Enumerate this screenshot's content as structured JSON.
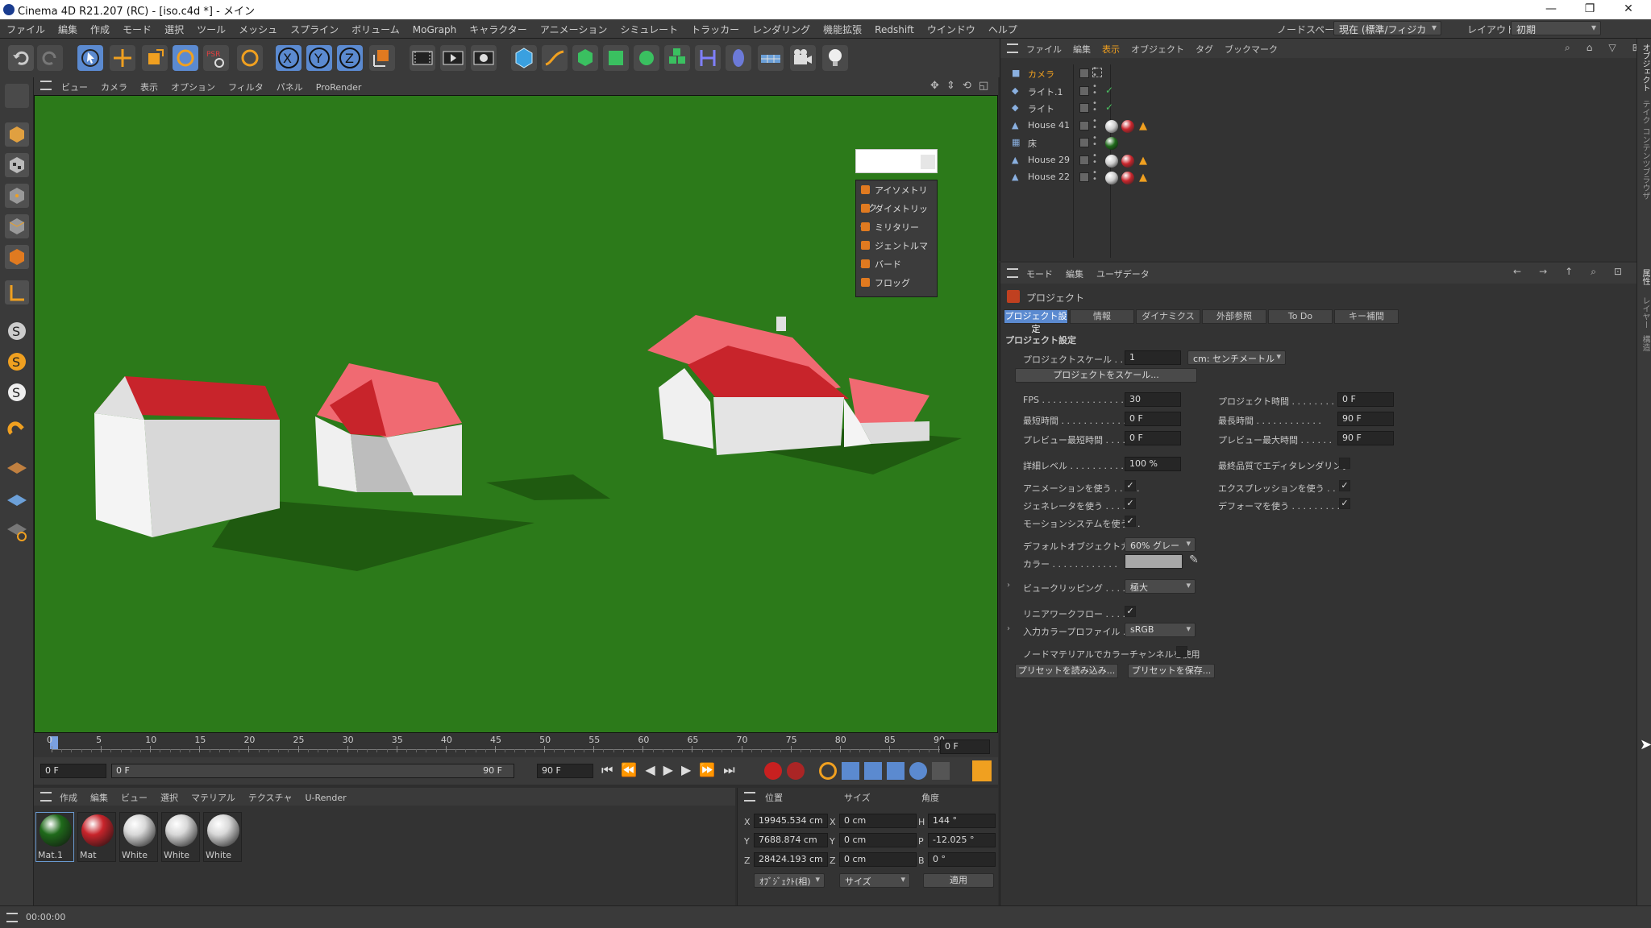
{
  "window": {
    "title": "Cinema 4D R21.207 (RC) - [iso.c4d *] - メイン",
    "minimize": "—",
    "restore": "❐",
    "close": "✕"
  },
  "menubar": {
    "items": [
      "ファイル",
      "編集",
      "作成",
      "モード",
      "選択",
      "ツール",
      "メッシュ",
      "スプライン",
      "ボリューム",
      "MoGraph",
      "キャラクター",
      "アニメーション",
      "シミュレート",
      "トラッカー",
      "レンダリング",
      "機能拡張",
      "Redshift",
      "ウインドウ",
      "ヘルプ"
    ],
    "nodespace_label": "ノードスペース:",
    "nodespace_value": "現在 (標準/フィジカル)",
    "layout_label": "レイアウト:",
    "layout_value": "初期"
  },
  "viewport": {
    "menu": [
      "ビュー",
      "カメラ",
      "表示",
      "オプション",
      "フィルタ",
      "パネル",
      "ProRender"
    ],
    "bg_color": "#2c7a1a",
    "popup_items": [
      "アイソメトリック",
      "ダイメトリック",
      "ミリタリー",
      "ジェントルマン",
      "バード",
      "フロッグ"
    ]
  },
  "timeline": {
    "ticks": [
      "0",
      "5",
      "10",
      "15",
      "20",
      "25",
      "30",
      "35",
      "40",
      "45",
      "50",
      "55",
      "60",
      "65",
      "70",
      "75",
      "80",
      "85",
      "90"
    ],
    "current_frame": "0 F"
  },
  "playbar": {
    "start": "0 F",
    "preview_start": "0 F",
    "preview_end": "90 F",
    "end": "90 F"
  },
  "material_manager": {
    "menu": [
      "作成",
      "編集",
      "ビュー",
      "選択",
      "マテリアル",
      "テクスチャ",
      "U-Render"
    ],
    "materials": [
      {
        "name": "Mat.1",
        "color": "#1f6a1a"
      },
      {
        "name": "Mat",
        "color": "#c8242b"
      },
      {
        "name": "White",
        "color": "#d8d8d8"
      },
      {
        "name": "White",
        "color": "#d8d8d8"
      },
      {
        "name": "White",
        "color": "#d8d8d8"
      }
    ]
  },
  "coords": {
    "headers": [
      "位置",
      "サイズ",
      "角度"
    ],
    "rows": [
      {
        "axis": "X",
        "pos": "19945.534 cm",
        "size_axis": "X",
        "size": "0 cm",
        "rot_axis": "H",
        "rot": "144 °"
      },
      {
        "axis": "Y",
        "pos": "7688.874 cm",
        "size_axis": "Y",
        "size": "0 cm",
        "rot_axis": "P",
        "rot": "-12.025 °"
      },
      {
        "axis": "Z",
        "pos": "28424.193 cm",
        "size_axis": "Z",
        "size": "0 cm",
        "rot_axis": "B",
        "rot": "0 °"
      }
    ],
    "mode_dropdown": "ｵﾌﾞｼﾞｪｸﾄ(相)",
    "size_dropdown": "サイズ",
    "apply": "適用"
  },
  "status": {
    "time": "00:00:00"
  },
  "object_manager": {
    "menu": [
      "ファイル",
      "編集",
      "表示",
      "オブジェクト",
      "タグ",
      "ブックマーク"
    ],
    "objects": [
      {
        "name": "カメラ",
        "highlight": true
      },
      {
        "name": "ライト.1",
        "highlight": false
      },
      {
        "name": "ライト",
        "highlight": false
      },
      {
        "name": "House 41",
        "highlight": false
      },
      {
        "name": "床",
        "highlight": false
      },
      {
        "name": "House 29",
        "highlight": false
      },
      {
        "name": "House 22",
        "highlight": false
      }
    ]
  },
  "attribute_manager": {
    "menu": [
      "モード",
      "編集",
      "ユーザデータ"
    ],
    "object": "プロジェクト",
    "tabs": [
      "プロジェクト設定",
      "情報",
      "ダイナミクス",
      "外部参照",
      "To Do",
      "キー補間"
    ],
    "section": "プロジェクト設定",
    "project_scale_label": "プロジェクトスケール . . . . .",
    "project_scale_value": "1",
    "project_scale_unit": "cm: センチメートル",
    "scale_button": "プロジェクトをスケール...",
    "fps_label": "FPS . . . . . . . . . . . . . . . .",
    "fps": "30",
    "project_time_label": "プロジェクト時間 . . . . . . . . .",
    "project_time": "0 F",
    "min_time_label": "最短時間 . . . . . . . . . . . . .",
    "min_time": "0 F",
    "max_time_label": "最長時間 . . . . . . . . . . . .",
    "max_time": "90 F",
    "prev_min_label": "プレビュー最短時間 . . . . . .",
    "prev_min": "0 F",
    "prev_max_label": "プレビュー最大時間 . . . . . .",
    "prev_max": "90 F",
    "lod_label": "詳細レベル . . . . . . . . . . .",
    "lod": "100 %",
    "render_lod_label": "最終品質でエディタレンダリング",
    "use_anim_label": "アニメーションを使う . . . . .",
    "use_expr_label": "エクスプレッションを使う . . . .",
    "use_gen_label": "ジェネレータを使う . . . . . .",
    "use_deform_label": "デフォーマを使う . . . . . . . . .",
    "use_motion_label": "モーションシステムを使う . .",
    "default_color_label": "デフォルトオブジェクトカラー",
    "default_color": "60% グレー",
    "color_label": "カラー . . . . . . . . . . . .",
    "view_clip_label": "ビュークリッピング . . . . . .",
    "view_clip": "極大",
    "linear_label": "リニアワークフロー . . . . . .",
    "input_profile_label": "入力カラープロファイル . . .",
    "input_profile": "sRGB",
    "node_mat_label": "ノードマテリアルでカラーチャンネルを使用",
    "load_preset": "プリセットを読み込み...",
    "save_preset": "プリセットを保存...",
    "check": "✓"
  },
  "right_strip": [
    "オブジェクト",
    "テイク",
    "コンテンツブラウザ",
    "属性",
    "レイヤー",
    "構造"
  ]
}
